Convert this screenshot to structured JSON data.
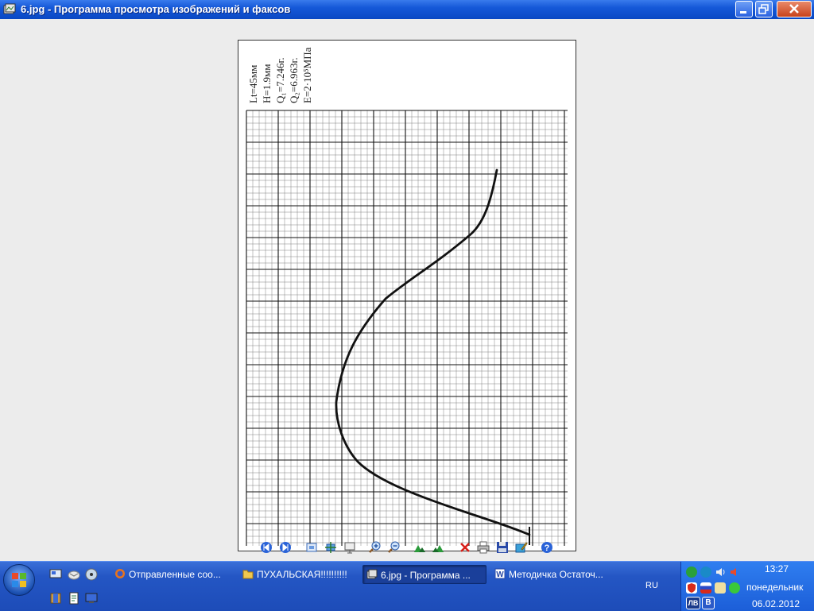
{
  "window": {
    "title": "6.jpg - Программа просмотра изображений и факсов"
  },
  "image": {
    "params": [
      "Lt=45мм",
      "H=1.9мм",
      "Q₁=7.246г.",
      "Q₂=6.963г.",
      "E=2·10⁵MПа"
    ]
  },
  "taskbar": {
    "tasks": [
      {
        "label": "Отправленные соо..."
      },
      {
        "label": "ПУХАЛЬСКАЯ!!!!!!!!!!"
      },
      {
        "label": "6.jpg - Программа ..."
      },
      {
        "label": "Методичка Остаточ..."
      }
    ],
    "language": "RU",
    "tray": {
      "l1": "ЛВ",
      "l2": "B"
    },
    "clock": {
      "time": "13:27",
      "day": "понедельник",
      "date": "06.02.2012"
    }
  }
}
